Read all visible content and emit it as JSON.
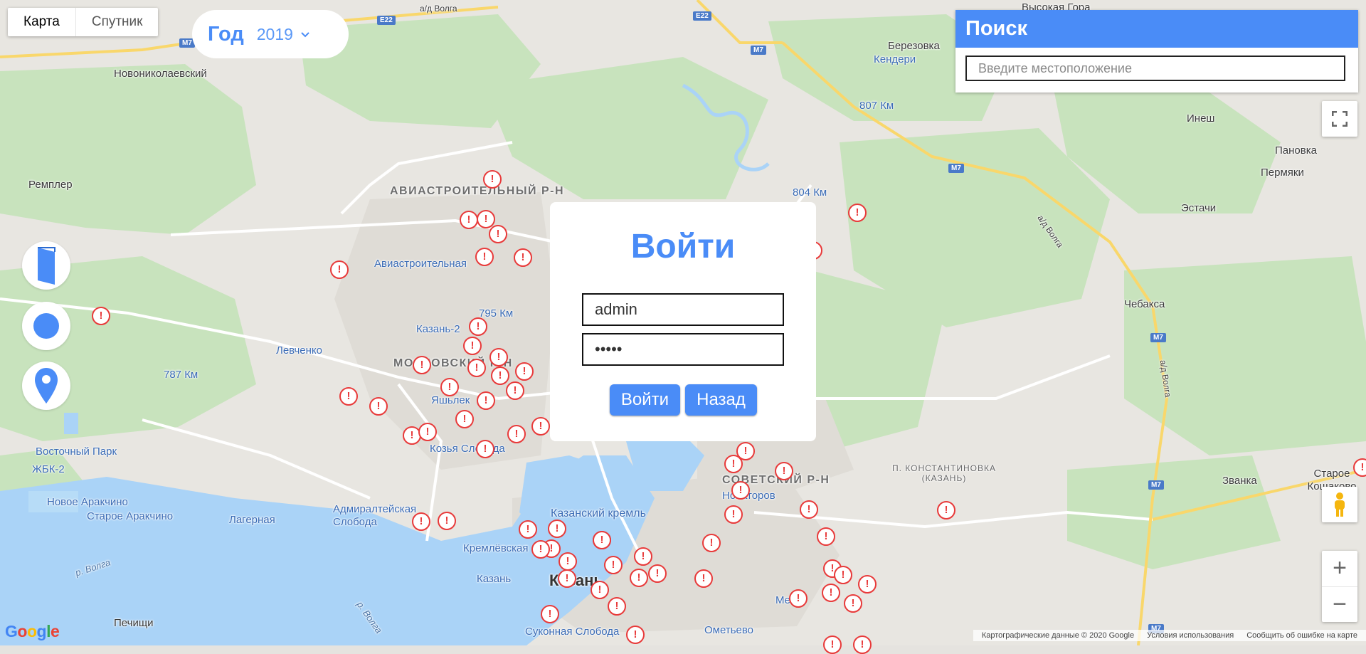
{
  "colors": {
    "accent": "#4a8cf7",
    "marker": "#e83a3a",
    "water": "#aad3f7",
    "park": "#cce8c3"
  },
  "map_type": {
    "map": "Карта",
    "satellite": "Спутник",
    "selected": "Карта"
  },
  "year_filter": {
    "label": "Год",
    "value": "2019",
    "icon": "chevron-down-icon"
  },
  "search": {
    "title": "Поиск",
    "placeholder": "Введите местоположение",
    "value": ""
  },
  "login": {
    "title": "Войти",
    "username": "admin",
    "password": "•••••",
    "submit_label": "Войти",
    "back_label": "Назад"
  },
  "tools": [
    "door-icon",
    "circle-icon",
    "pin-icon"
  ],
  "map_controls": {
    "fullscreen": "fullscreen-icon",
    "pegman": "pegman-icon",
    "zoom_in": "+",
    "zoom_out": "−"
  },
  "map_labels": {
    "l1": "Новониколаевский",
    "l2": "Ремплер",
    "l3": "АВИАСТРОИТЕЛЬНЫЙ Р-Н",
    "l4": "Авиастроительная",
    "l5": "Левченко",
    "l6": "787 Км",
    "l7": "Казань-2",
    "l8": "МОСКОВСКИЙ Р-Н",
    "l9": "Яшьлек",
    "l10": "Козья Слобода",
    "l11": "Восточный Парк",
    "l12": "ЖБК-2",
    "l13": "Новое Аракчино",
    "l14": "Старое Аракчино",
    "l15": "Лагерная",
    "l16": "Адмиралтейская Слобода",
    "l17": "Кремлёвская",
    "l18": "Казань",
    "l19": "Казань",
    "l20": "Казанский кремль",
    "l21": "Печищи",
    "l22": "Суконная Слобода",
    "l23": "Ометьево",
    "l24": "СОВЕТСКИЙ Р-Н",
    "l25": "Новаторов",
    "l26": "П. КОНСТАНТИНОВКА (КАЗАНЬ)",
    "l27": "Березовка",
    "l28": "Кендери",
    "l29": "Высокая Гора",
    "l30": "807 Км",
    "l31": "804 Км",
    "l32": "Инеш",
    "l33": "Пановка",
    "l34": "Пермяки",
    "l35": "Эстачи",
    "l36": "Чебакса",
    "l37": "Званка",
    "l38": "Старое Кощаково",
    "l39": "795 Км",
    "l40": "р. Волга",
    "l41": "р. Волга",
    "l42": "а/д Волга",
    "l43": "а/д Волга",
    "l44": "а/д Волга",
    "l45": "Ме",
    "l46": "Кощаково"
  },
  "road_shields": [
    "E22",
    "E22",
    "M7",
    "M7",
    "M7",
    "M7",
    "M7",
    "M7"
  ],
  "marker_symbol": "!",
  "footer": {
    "logo": "Google",
    "map_data": "Картографические данные © 2020 Google",
    "terms": "Условия использования",
    "report": "Сообщить об ошибке на карте"
  }
}
